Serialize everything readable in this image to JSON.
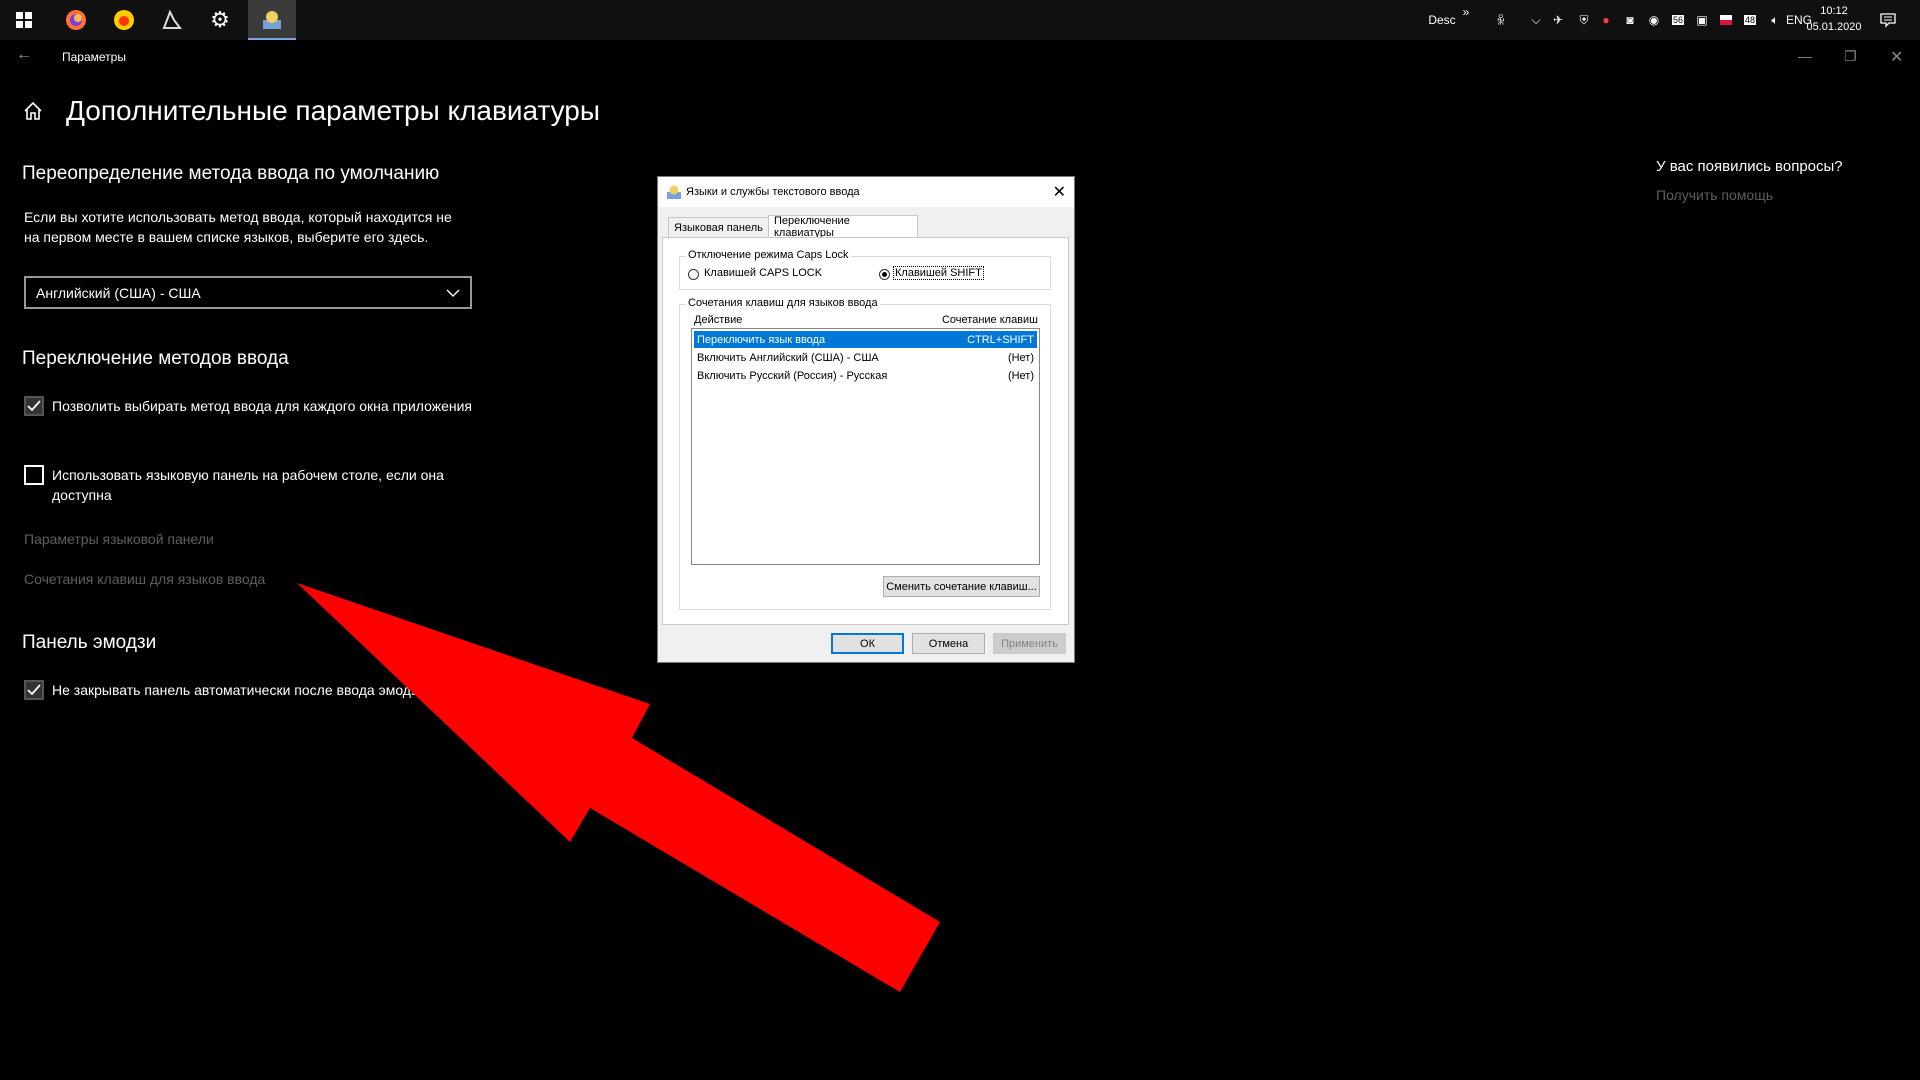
{
  "taskbar": {
    "apps": [
      {
        "name": "firefox-icon"
      },
      {
        "name": "yandex-browser-icon"
      },
      {
        "name": "kali-dragon-icon"
      },
      {
        "name": "settings-gear-icon"
      },
      {
        "name": "language-services-icon"
      }
    ],
    "tray": {
      "desc_label": "Desc",
      "overflow": "»",
      "language": "ENG",
      "time": "10:12",
      "date": "05.01.2020"
    }
  },
  "settings": {
    "window_title": "Параметры",
    "page_title": "Дополнительные параметры клавиатуры",
    "override": {
      "heading": "Переопределение метода ввода по умолчанию",
      "description": "Если вы хотите использовать метод ввода, который находится не на первом месте в вашем списке языков, выберите его здесь.",
      "selected_value": "Английский (США) - США"
    },
    "switching": {
      "heading": "Переключение методов ввода",
      "option1": {
        "label": "Позволить выбирать метод ввода для каждого окна приложения",
        "checked": true
      },
      "option2": {
        "label": "Использовать языковую панель на рабочем столе, если она доступна",
        "checked": false
      },
      "link1": "Параметры языковой панели",
      "link2": "Сочетания клавиш для языков ввода"
    },
    "emoji": {
      "heading": "Панель эмодзи",
      "option": {
        "label": "Не закрывать панель автоматически после ввода эмодзи",
        "checked": true
      }
    },
    "help": {
      "question": "У вас появились вопросы?",
      "link": "Получить помощь"
    }
  },
  "dialog": {
    "title": "Языки и службы текстового ввода",
    "tabs": [
      "Языковая панель",
      "Переключение клавиатуры"
    ],
    "active_tab": 1,
    "capslock_group": "Отключение режима Caps Lock",
    "capslock_options": [
      {
        "label": "Клавишей CAPS LOCK",
        "selected": false
      },
      {
        "label": "Клавишей SHIFT",
        "selected": true
      }
    ],
    "hotkeys_group": "Сочетания клавиш для языков ввода",
    "columns": [
      "Действие",
      "Сочетание клавиш"
    ],
    "rows": [
      {
        "action": "Переключить язык ввода",
        "keys": "CTRL+SHIFT"
      },
      {
        "action": "Включить Английский (США) - США",
        "keys": "(Нет)"
      },
      {
        "action": "Включить Русский (Россия) - Русская",
        "keys": "(Нет)"
      }
    ],
    "selected_row": 0,
    "change_button": "Сменить сочетание клавиш...",
    "ok": "ОК",
    "cancel": "Отмена",
    "apply": "Применить"
  },
  "colors": {
    "arrow": "#ff0000",
    "selection": "#0078d7"
  }
}
